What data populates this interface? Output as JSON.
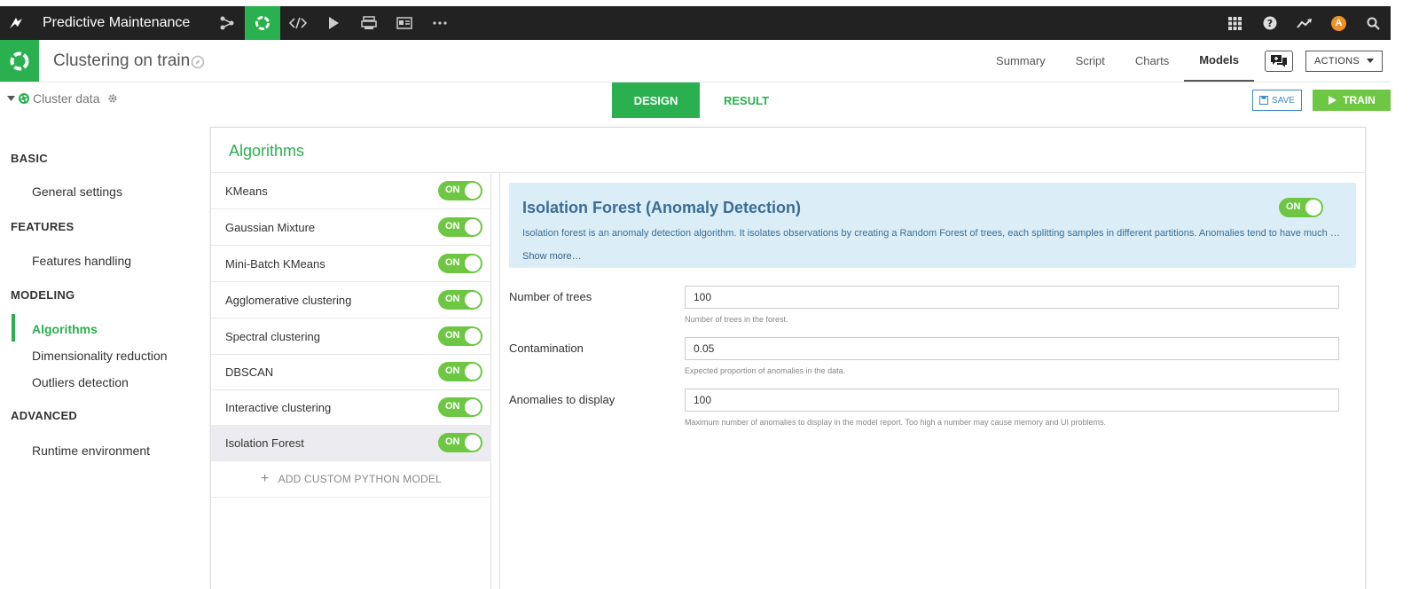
{
  "topbar": {
    "project_name": "Predictive Maintenance",
    "nav_icons": [
      "bird-logo-icon",
      "flow-icon",
      "lab-icon",
      "code-icon",
      "play-icon",
      "deploy-icon",
      "dashboard-icon",
      "more-icon"
    ],
    "right_icons": [
      "apps-grid-icon",
      "help-icon",
      "activity-icon",
      "avatar",
      "search-icon"
    ],
    "avatar_letter": "A"
  },
  "header": {
    "title": "Clustering on train",
    "tabs": [
      {
        "label": "Summary"
      },
      {
        "label": "Script"
      },
      {
        "label": "Charts"
      },
      {
        "label": "Models"
      }
    ],
    "active_tab": "Models",
    "actions_label": "ACTIONS"
  },
  "subheader": {
    "cluster_data_label": "Cluster data",
    "design_label": "DESIGN",
    "result_label": "RESULT",
    "save_label": "SAVE",
    "train_label": "TRAIN"
  },
  "sidebar": {
    "sections": [
      {
        "title": "BASIC",
        "items": [
          "General settings"
        ]
      },
      {
        "title": "FEATURES",
        "items": [
          "Features handling"
        ]
      },
      {
        "title": "MODELING",
        "items": [
          "Algorithms",
          "Dimensionality reduction",
          "Outliers detection"
        ]
      },
      {
        "title": "ADVANCED",
        "items": [
          "Runtime environment"
        ]
      }
    ],
    "active_item": "Algorithms"
  },
  "panel": {
    "title": "Algorithms",
    "algorithms": [
      {
        "name": "KMeans",
        "toggle": "ON"
      },
      {
        "name": "Gaussian Mixture",
        "toggle": "ON"
      },
      {
        "name": "Mini-Batch KMeans",
        "toggle": "ON"
      },
      {
        "name": "Agglomerative clustering",
        "toggle": "ON"
      },
      {
        "name": "Spectral clustering",
        "toggle": "ON"
      },
      {
        "name": "DBSCAN",
        "toggle": "ON"
      },
      {
        "name": "Interactive clustering",
        "toggle": "ON"
      },
      {
        "name": "Isolation Forest",
        "toggle": "ON"
      }
    ],
    "selected_algorithm": "Isolation Forest",
    "add_custom_label": "ADD CUSTOM PYTHON MODEL"
  },
  "detail": {
    "title": "Isolation Forest (Anomaly Detection)",
    "toggle": "ON",
    "description": "Isolation forest is an anomaly detection algorithm. It isolates observations by creating a Random Forest of trees, each splitting samples in different partitions. Anomalies tend to have much …",
    "show_more": "Show more…",
    "params": [
      {
        "label": "Number of trees",
        "value": "100",
        "help": "Number of trees in the forest."
      },
      {
        "label": "Contamination",
        "value": "0.05",
        "help": "Expected proportion of anomalies in the data."
      },
      {
        "label": "Anomalies to display",
        "value": "100",
        "help": "Maximum number of anomalies to display in the model report. Too high a number may cause memory and UI problems."
      }
    ]
  },
  "colors": {
    "accent": "#2ab04f",
    "toggle": "#6ec743",
    "topbar": "#222222",
    "detail_bg": "#dbeef7",
    "detail_text": "#3a6d97"
  }
}
